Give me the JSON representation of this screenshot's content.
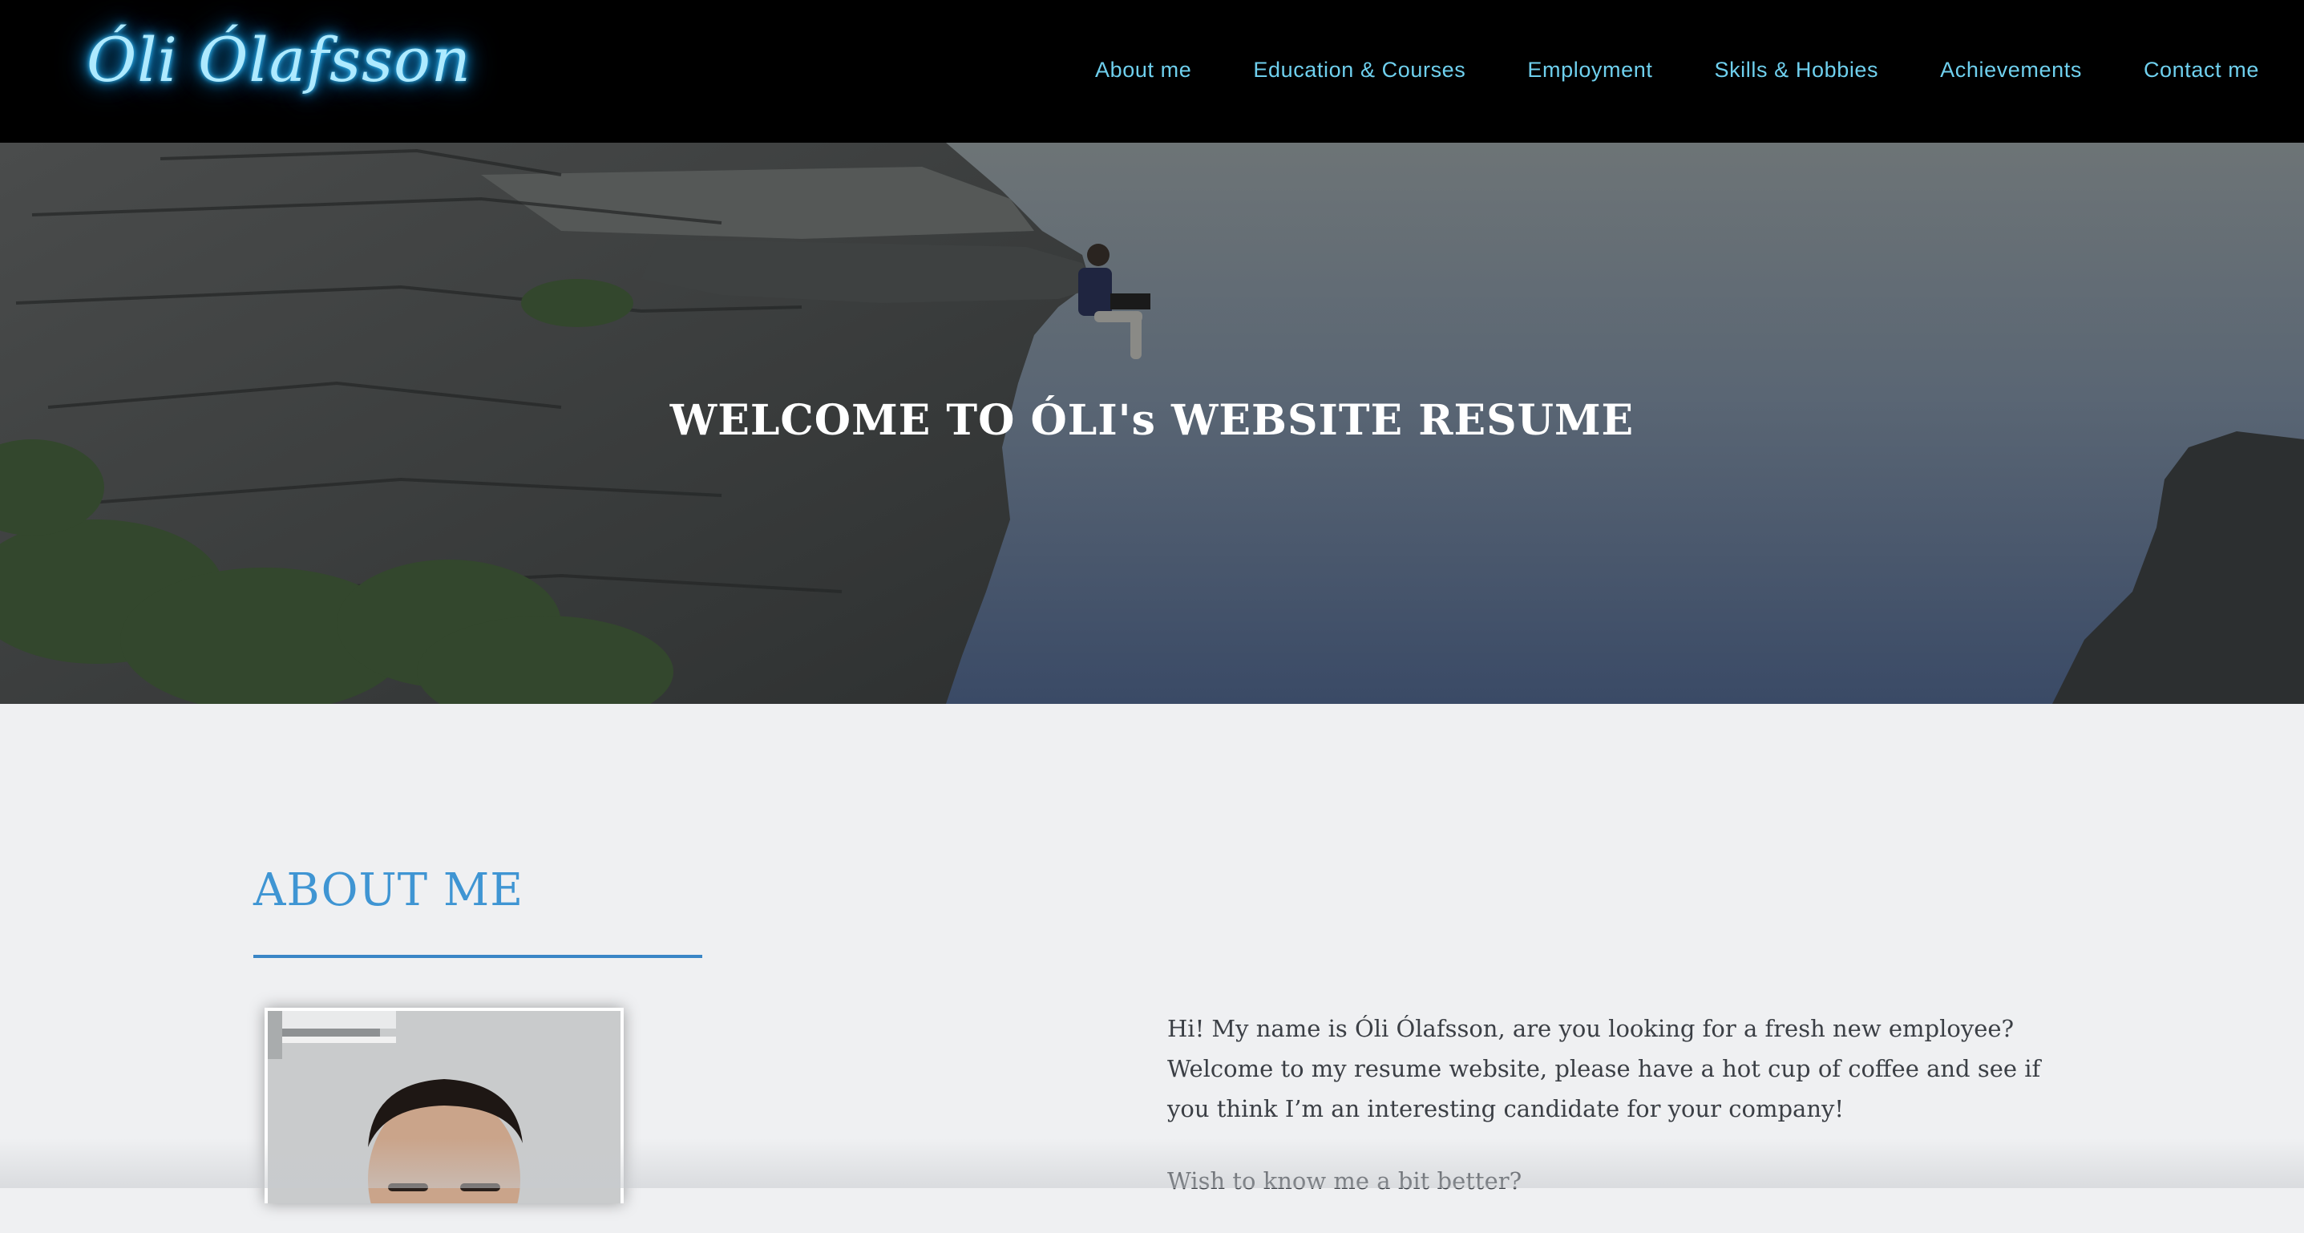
{
  "header": {
    "logo_text": "Óli Ólafsson",
    "nav": [
      {
        "label": "About me"
      },
      {
        "label": "Education & Courses"
      },
      {
        "label": "Employment"
      },
      {
        "label": "Skills & Hobbies"
      },
      {
        "label": "Achievements"
      },
      {
        "label": "Contact me"
      }
    ],
    "nav_color": "#6fd0ee",
    "logo_glow_color": "#39c2ff"
  },
  "hero": {
    "title": "WELCOME TO ÓLI's WEBSITE RESUME"
  },
  "about": {
    "heading": "ABOUT ME",
    "accent_color": "#3f95d3",
    "paragraphs": [
      "Hi! My name is Óli Ólafsson, are you looking for a fresh new employee? Welcome to my resume website, please have a hot cup of coffee and see if you think I’m an interesting candidate for your company!",
      "Wish to know me a bit better?"
    ]
  }
}
